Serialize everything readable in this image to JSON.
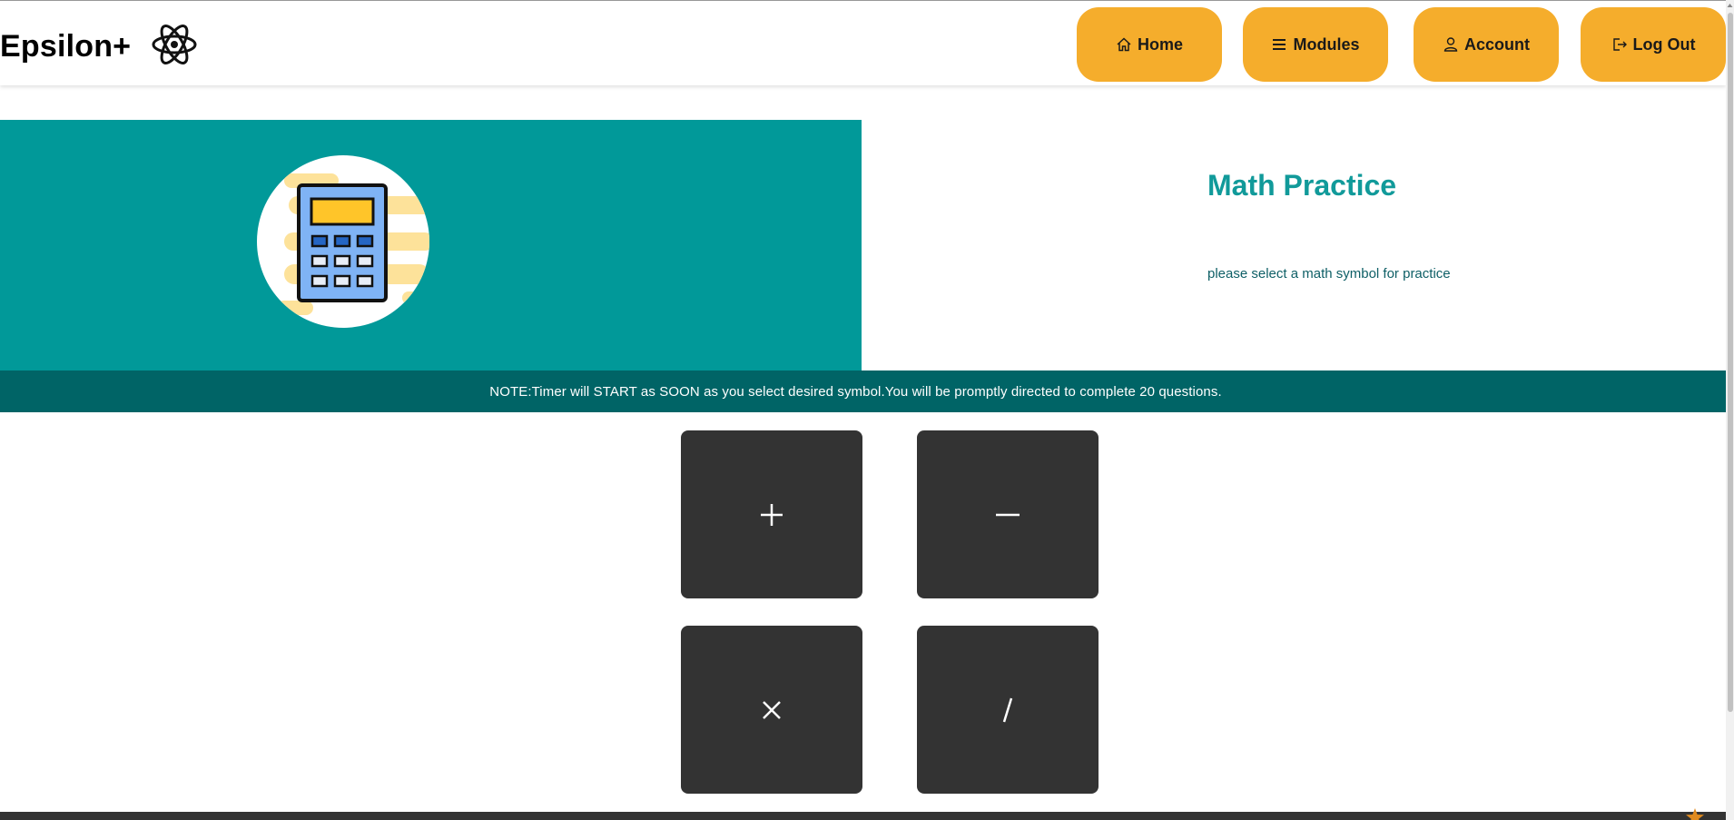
{
  "navbar": {
    "brand": "Epsilon+",
    "buttons": {
      "home": "Home",
      "modules": "Modules",
      "account": "Account",
      "logout": "Log Out"
    }
  },
  "hero": {
    "title": "Math Practice",
    "subtitle": "please select a math symbol for practice",
    "image_icon": "calculator-icon"
  },
  "note": "NOTE:Timer will START as SOON as you select desired symbol.You will be promptly directed to complete 20 questions.",
  "operations": [
    {
      "symbol": "plus",
      "icon": "plus-icon"
    },
    {
      "symbol": "minus",
      "icon": "minus-icon"
    },
    {
      "symbol": "multiply",
      "icon": "multiply-icon"
    },
    {
      "symbol": "divide",
      "icon": "divide-slash-icon"
    }
  ],
  "colors": {
    "accent": "#f5ad2c",
    "hero_bg": "#019999",
    "note_bg": "#006466",
    "title": "#119a9a",
    "op_button": "#333333"
  }
}
